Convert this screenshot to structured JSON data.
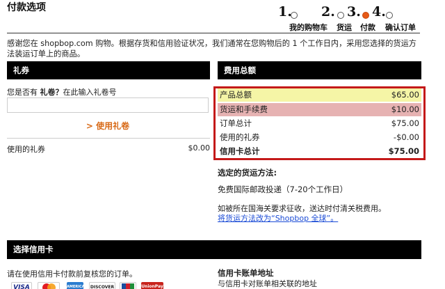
{
  "page_title": "付款选项",
  "steps": [
    {
      "num": "1.",
      "label": "我的购物车",
      "active": false
    },
    {
      "num": "2.",
      "label": "货运",
      "active": false
    },
    {
      "num": "3.",
      "label": "付款",
      "active": true
    },
    {
      "num": "4.",
      "label": "确认订单",
      "active": false
    }
  ],
  "intro_text": "感谢您在 shopbop.com 购物。根据存货和信用验证状况，我们通常在您购物后的 1 个工作日内，采用您选择的货运方法装运订单上的商品。",
  "coupon": {
    "header": "礼券",
    "question_prefix": "您是否有 ",
    "question_bold": "礼卷？",
    "question_suffix": "在此输入礼卷号",
    "input_value": "",
    "use_button": "> 使用礼卷",
    "used_label": "使用的礼券",
    "used_amount": "$0.00"
  },
  "totals": {
    "header": "费用总额",
    "rows": [
      {
        "label": "产品总额",
        "value": "$65.00"
      },
      {
        "label": "货运和手续费",
        "value": "$10.00"
      },
      {
        "label": "订单总计",
        "value": "$75.00"
      },
      {
        "label": "使用的礼券",
        "value": "-$0.00"
      },
      {
        "label": "信用卡总计",
        "value": "$75.00"
      }
    ],
    "highlight_color": "#c41919"
  },
  "shipping": {
    "title": "选定的货运方法:",
    "method": "免费国际邮政投递（7-20个工作日）",
    "customs_note": "如被所在国海关要求征收，送达时付清关税费用。",
    "change_link": "将货运方法改为“Shopbop 全球”。"
  },
  "credit_card": {
    "header": "选择信用卡",
    "instruction": "请在使用信用卡付款前复核您的订单。",
    "billing_title": "信用卡账单地址",
    "billing_subtitle": "与信用卡对账单相关联的地址",
    "cards": [
      {
        "name": "visa-card-icon",
        "text": "VISA"
      },
      {
        "name": "mastercard-icon",
        "text": ""
      },
      {
        "name": "amex-card-icon",
        "text": "AMERICAN EXPRESS"
      },
      {
        "name": "discover-card-icon",
        "text": "DISCOVER"
      },
      {
        "name": "jcb-card-icon",
        "text": ""
      },
      {
        "name": "unionpay-card-icon",
        "text": "UnionPay"
      }
    ]
  },
  "colors": {
    "accent_orange": "#d86a18",
    "active_step": "#e65a17",
    "link_blue": "#1a4bd6",
    "yellow_highlight": "#f5f5a6",
    "pink_highlight": "#e6b2b2"
  }
}
